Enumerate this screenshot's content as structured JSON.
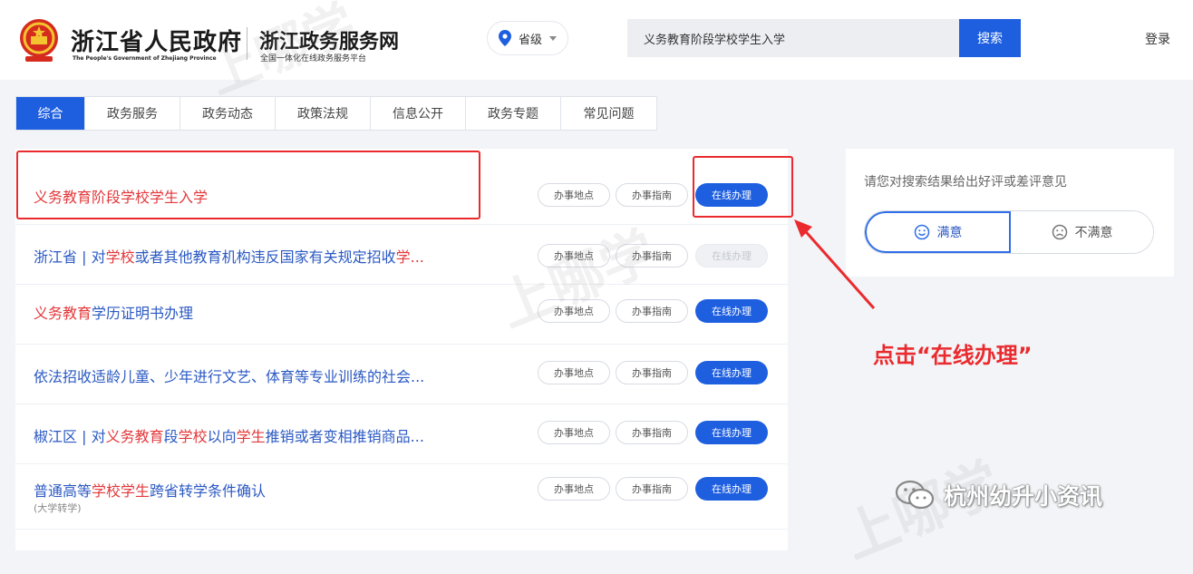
{
  "header": {
    "logo_title": "浙江省人民政府",
    "logo_subtitle": "The People's Government of Zhejiang Province",
    "portal_title": "浙江政务服务网",
    "portal_subtitle": "全国一体化在线政务服务平台",
    "region": "省级",
    "search_value": "义务教育阶段学校学生入学",
    "search_button": "搜索",
    "login": "登录"
  },
  "tabs": [
    {
      "label": "综合",
      "active": true
    },
    {
      "label": "政务服务",
      "active": false
    },
    {
      "label": "政务动态",
      "active": false
    },
    {
      "label": "政策法规",
      "active": false
    },
    {
      "label": "信息公开",
      "active": false
    },
    {
      "label": "政务专题",
      "active": false
    },
    {
      "label": "常见问题",
      "active": false
    }
  ],
  "row_buttons": {
    "location": "办事地点",
    "guide": "办事指南",
    "online": "在线办理"
  },
  "results": [
    {
      "parts": [
        {
          "text": "义务教育阶段学校学生入学",
          "hl": true
        }
      ],
      "sub": "",
      "online_enabled": true
    },
    {
      "parts": [
        {
          "text": "浙江省 | 对",
          "hl": false
        },
        {
          "text": "学校",
          "hl": true
        },
        {
          "text": "或者其他教育机构违反国家有关规定招收",
          "hl": false
        },
        {
          "text": "学...",
          "hl": true
        }
      ],
      "sub": "",
      "online_enabled": false
    },
    {
      "parts": [
        {
          "text": "义务教育",
          "hl": true
        },
        {
          "text": "学历证明书办理",
          "hl": false
        }
      ],
      "sub": "",
      "online_enabled": true
    },
    {
      "parts": [
        {
          "text": "依法招收适龄儿童、少年进行文艺、体育等专业训练的社会...",
          "hl": false
        }
      ],
      "sub": "",
      "online_enabled": true
    },
    {
      "parts": [
        {
          "text": "椒江区 | 对",
          "hl": false
        },
        {
          "text": "义务教育",
          "hl": true
        },
        {
          "text": "段",
          "hl": false
        },
        {
          "text": "学校",
          "hl": true
        },
        {
          "text": "以向",
          "hl": false
        },
        {
          "text": "学生",
          "hl": true
        },
        {
          "text": "推销或者变相推销商品...",
          "hl": false
        }
      ],
      "sub": "",
      "online_enabled": true
    },
    {
      "parts": [
        {
          "text": "普通高等",
          "hl": false
        },
        {
          "text": "学校学生",
          "hl": true
        },
        {
          "text": "跨省转学条件确认",
          "hl": false
        }
      ],
      "sub": "(大学转学)",
      "online_enabled": true
    }
  ],
  "feedback": {
    "prompt": "请您对搜索结果给出好评或差评意见",
    "satisfied": "满意",
    "unsatisfied": "不满意"
  },
  "annotation": {
    "callout": "点击“在线办理”"
  },
  "watermark": {
    "brand": "杭州幼升小资讯",
    "mark": "上哪学"
  },
  "colors": {
    "primary": "#1e5fe0",
    "highlight": "#e3393c",
    "link": "#2b59c3",
    "annotation": "#ea2a2e"
  }
}
